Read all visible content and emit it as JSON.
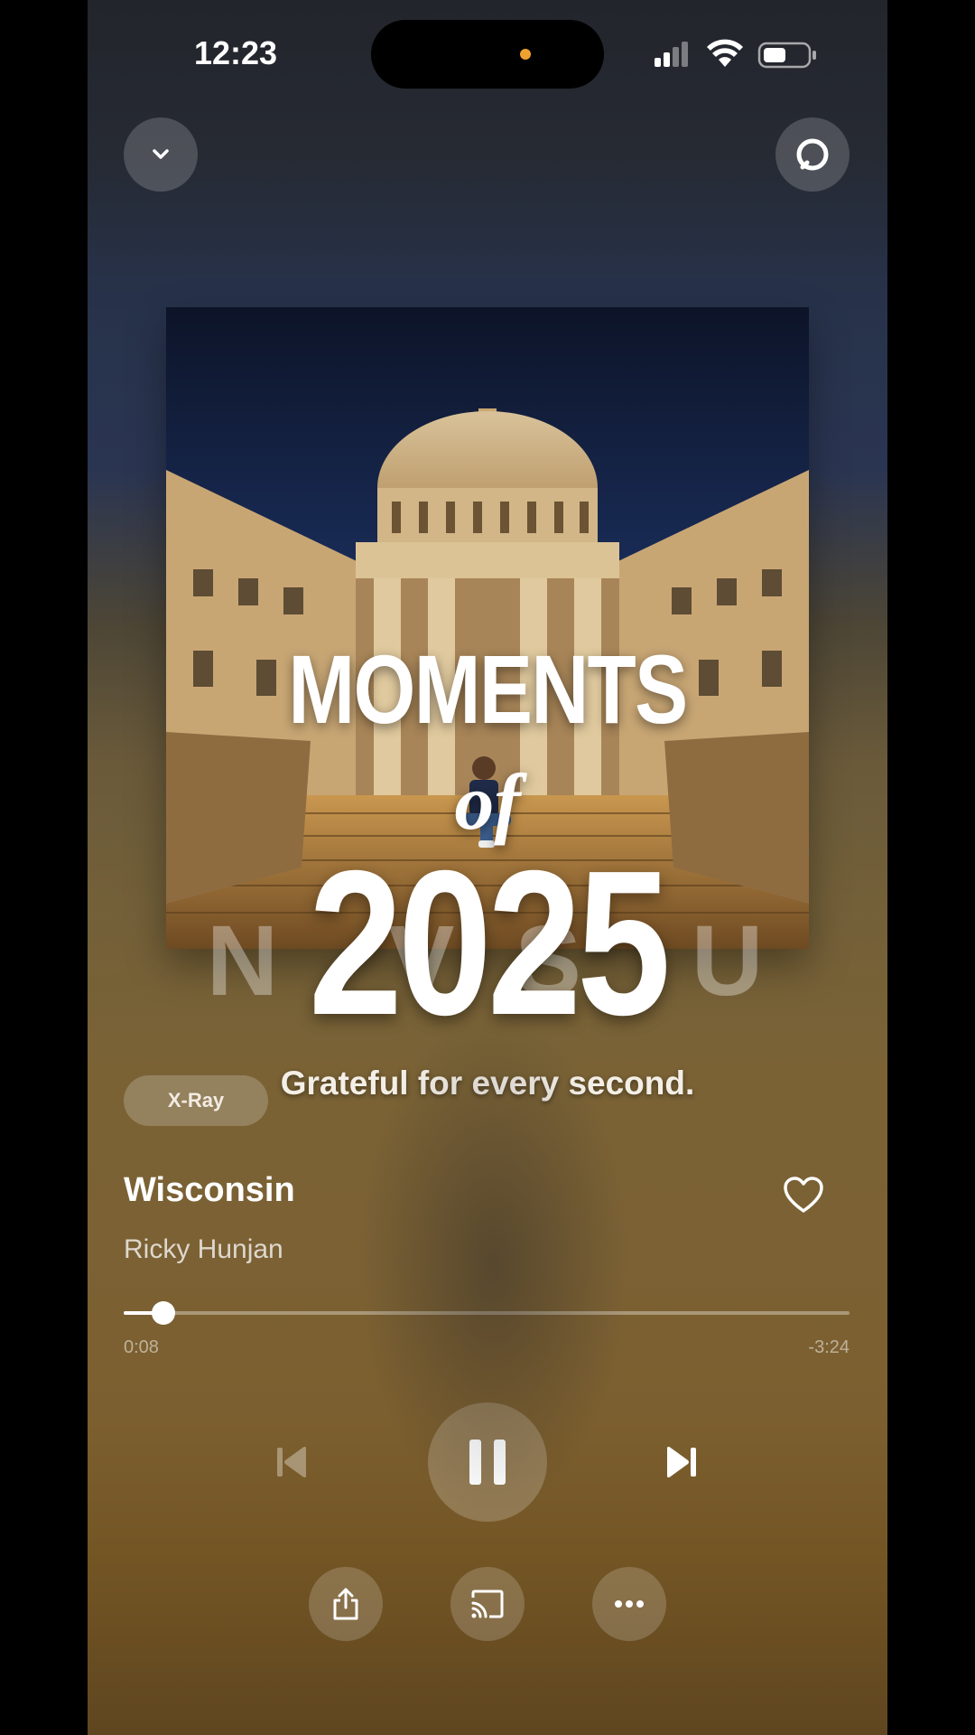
{
  "status_bar": {
    "time": "12:23"
  },
  "header": {
    "collapse_icon": "chevron-down-icon",
    "alexa_icon": "alexa-ring-icon"
  },
  "artwork": {
    "overlay_line1": "MOMENTS",
    "overlay_line2": "of",
    "overlay_line3": "2025",
    "tagline": "Grateful for every second."
  },
  "xray": {
    "label": "X-Ray"
  },
  "track": {
    "title": "Wisconsin",
    "artist": "Ricky Hunjan",
    "elapsed": "0:08",
    "remaining": "-3:24",
    "progress_fraction": 0.055
  },
  "controls": {
    "previous_icon": "skip-previous-icon",
    "play_pause_icon": "pause-icon",
    "next_icon": "skip-next-icon",
    "share_icon": "share-icon",
    "cast_icon": "cast-icon",
    "more_icon": "more-icon",
    "like_icon": "heart-icon"
  },
  "colors": {
    "accent_dot": "#f0a230"
  }
}
